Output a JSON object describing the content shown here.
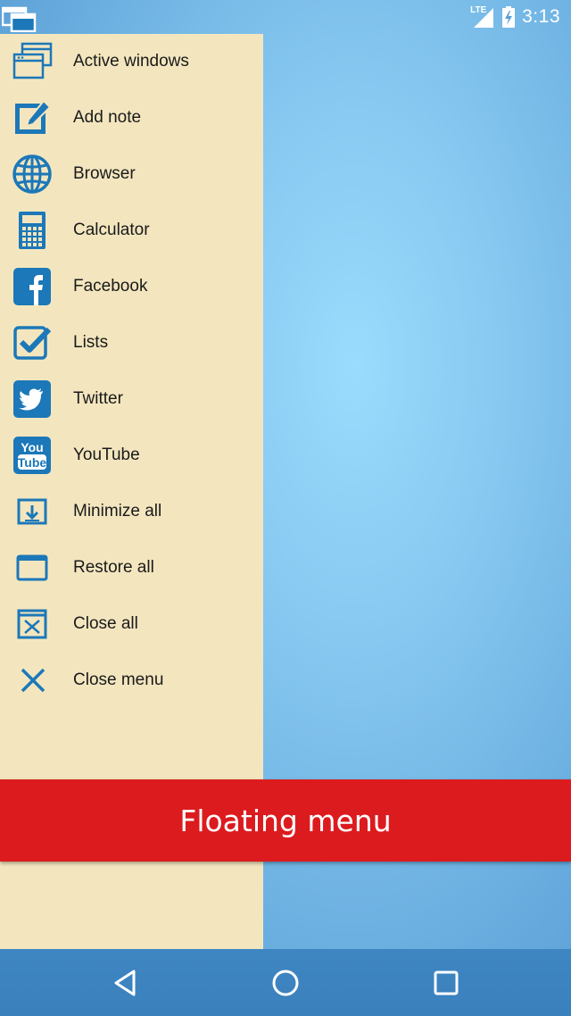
{
  "status_bar": {
    "network": "LTE",
    "time": "3:13"
  },
  "menu": {
    "items": [
      {
        "label": "Active windows",
        "icon": "active-windows-icon"
      },
      {
        "label": "Add note",
        "icon": "add-note-icon"
      },
      {
        "label": "Browser",
        "icon": "globe-icon"
      },
      {
        "label": "Calculator",
        "icon": "calculator-icon"
      },
      {
        "label": "Facebook",
        "icon": "facebook-icon"
      },
      {
        "label": "Lists",
        "icon": "checkbox-icon"
      },
      {
        "label": "Twitter",
        "icon": "twitter-bird-icon"
      },
      {
        "label": "YouTube",
        "icon": "youtube-icon"
      },
      {
        "label": "Minimize all",
        "icon": "minimize-icon"
      },
      {
        "label": "Restore all",
        "icon": "restore-icon"
      },
      {
        "label": "Close all",
        "icon": "close-all-icon"
      },
      {
        "label": "Close menu",
        "icon": "close-icon"
      }
    ]
  },
  "banner": {
    "title": "Floating menu"
  },
  "nav_bar": {
    "buttons": [
      "back-icon",
      "home-icon",
      "recents-icon"
    ]
  },
  "colors": {
    "accent_blue": "#1c78b8",
    "menu_background": "#f3e6bf",
    "banner_red": "#dc1b1f"
  }
}
